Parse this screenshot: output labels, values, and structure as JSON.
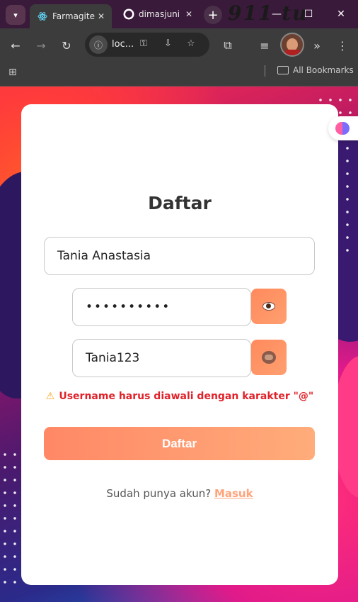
{
  "browser": {
    "tabs": [
      {
        "title": "Farmagite",
        "icon": "react-icon",
        "active": true
      },
      {
        "title": "dimasjuni",
        "icon": "github-icon",
        "active": false
      }
    ],
    "tab_close_glyph": "✕",
    "new_tab_glyph": "+",
    "decor_text": "911 tu",
    "window_controls": {
      "minimize": "—",
      "maximize": "☐",
      "close": "✕"
    },
    "url": "loc...",
    "nav": {
      "back": "←",
      "forward": "→",
      "reload": "↻",
      "info": "ⓘ",
      "key": "⚿",
      "install": "⇩",
      "star": "☆",
      "extensions": "⧉",
      "media": "≡",
      "overflow": "»",
      "menu": "⋮"
    },
    "bookmarks": {
      "apps_glyph": "⊞",
      "all_bookmarks": "All Bookmarks"
    }
  },
  "form": {
    "title": "Daftar",
    "name_value": "Tania Anastasia",
    "password_value": "••••••••••",
    "username_value": "Tania123",
    "error_icon": "⚠",
    "error_text": "Username harus diawali dengan karakter \"@\"",
    "submit_label": "Daftar",
    "login_prompt": "Sudah punya akun?",
    "login_link": "Masuk"
  },
  "colors": {
    "accent_start": "#ff8866",
    "accent_end": "#ffac7a",
    "error": "#e0222a",
    "link": "#ffa37a"
  }
}
